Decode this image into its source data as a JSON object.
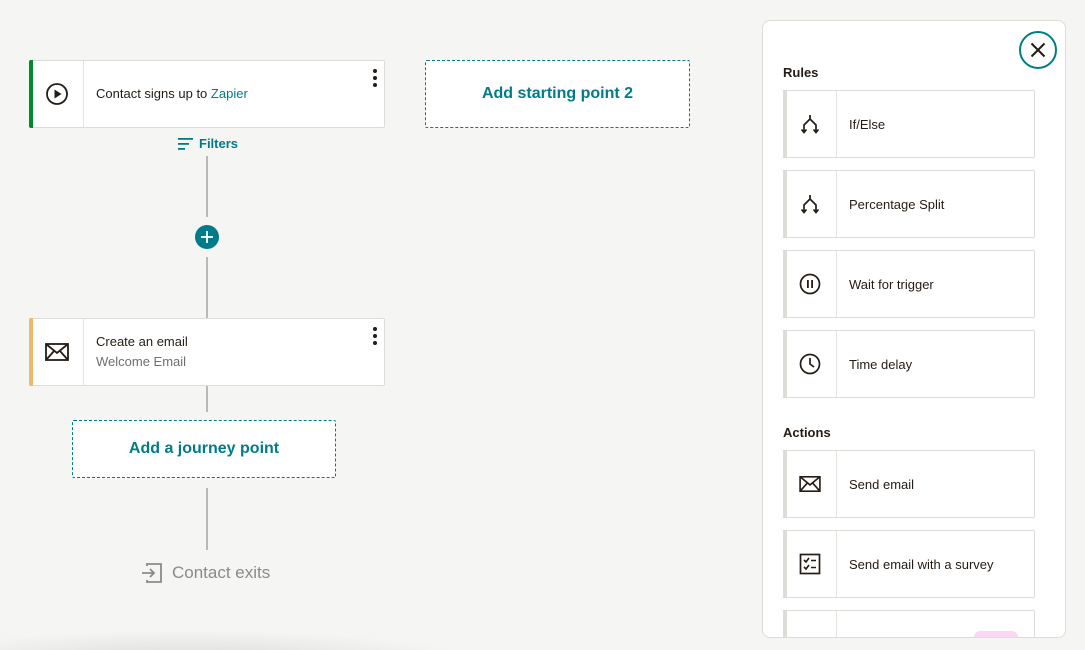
{
  "canvas": {
    "trigger_card": {
      "text": "Contact signs up to",
      "link": "Zapier",
      "accent_color": "#00892f"
    },
    "filters_label": "Filters",
    "email_card": {
      "title": "Create an email",
      "subtitle": "Welcome Email",
      "accent_color": "#e9b96e"
    },
    "add_starting_point": "Add starting point 2",
    "add_journey_point": "Add a journey point",
    "contact_exits": "Contact exits"
  },
  "panel": {
    "rules_title": "Rules",
    "rules": [
      {
        "label": "If/Else",
        "icon": "branch-icon"
      },
      {
        "label": "Percentage Split",
        "icon": "split-icon"
      },
      {
        "label": "Wait for trigger",
        "icon": "pause-icon"
      },
      {
        "label": "Time delay",
        "icon": "clock-icon"
      }
    ],
    "actions_title": "Actions",
    "actions": [
      {
        "label": "Send email",
        "icon": "envelope-icon"
      },
      {
        "label": "Send email with a survey",
        "icon": "survey-icon"
      },
      {
        "label": "",
        "icon": "tag-icon"
      }
    ]
  },
  "colors": {
    "brand": "#007c89",
    "background": "#f5f5f3"
  }
}
